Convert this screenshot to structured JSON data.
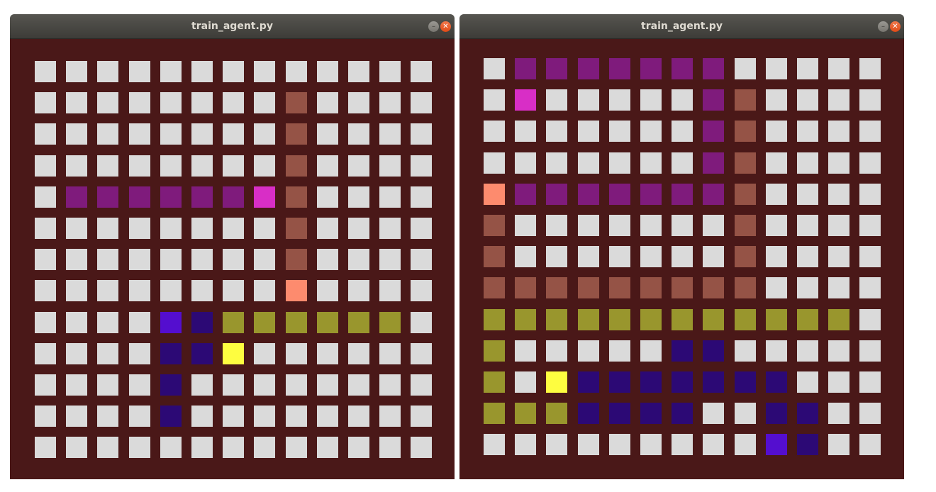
{
  "palette": {
    "background": "#4a1818",
    "E": "#dadada",
    "P": "#7f1b7c",
    "H": "#d82ec6",
    "B": "#955346",
    "S": "#fd8b6e",
    "O": "#99962d",
    "Y": "#fefd40",
    "N": "#2c0975",
    "V": "#540ecf"
  },
  "windows": [
    {
      "title": "train_agent.py",
      "grid": [
        "EEEEEEEEEEEEE",
        "EEEEEEEEBEEEE",
        "EEEEEEEEBEEEE",
        "EEEEEEEEBEEEE",
        "EPPPPPPHBEEEE",
        "EEEEEEEEBEEEE",
        "EEEEEEEEBEEEE",
        "EEEEEEEESEEEE",
        "EEEEVNOOOOOOE",
        "EEEENNYEEEEEE",
        "EEEENEEEEEEEE",
        "EEEENEEEEEEEE",
        "EEEEEEEEEEEEE"
      ]
    },
    {
      "title": "train_agent.py",
      "grid": [
        "EPPPPPPPEEEEE",
        "EHEEEEEPBEEEE",
        "EEEEEEEPBEEEE",
        "EEEEEEEPBEEEE",
        "SPPPPPPPBEEEE",
        "BEEEEEEEBEEEE",
        "BEEEEEEEBEEEE",
        "BBBBBBBBBEEEE",
        "OOOOOOOOOOOOE",
        "OEEEEENNEEEEE",
        "OEYNNNNNNNEEE",
        "OOONNNNEENNEE",
        "EEEEEEEEEVNEE"
      ]
    }
  ]
}
